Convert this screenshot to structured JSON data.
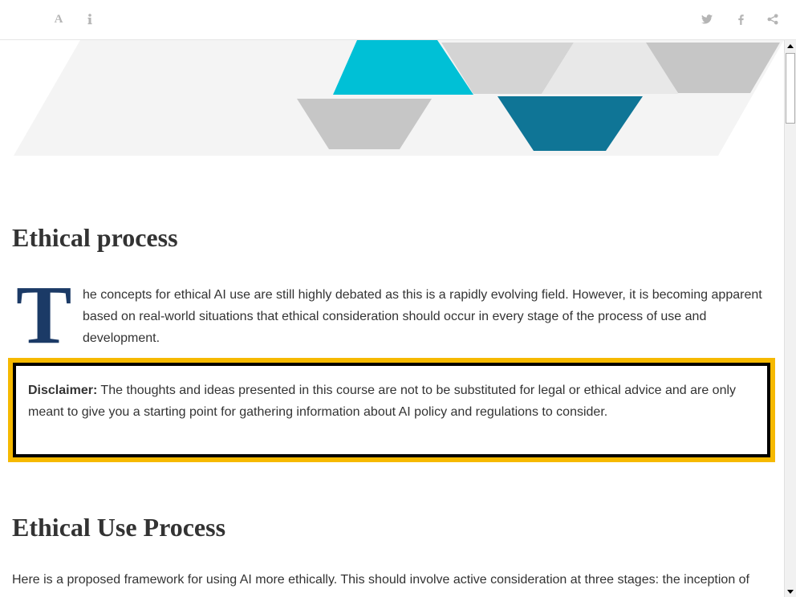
{
  "toolbar": {
    "font_icon_glyph": "A",
    "left_icons": [
      "font-size-icon",
      "info-icon"
    ],
    "right_icons": [
      "twitter-icon",
      "facebook-icon",
      "share-icon"
    ],
    "icon_color": "#b5b5b5"
  },
  "banner": {
    "colors": {
      "cyan": "#00c0d6",
      "teal": "#0f7596",
      "grey": "#c6c6c6",
      "light_grey": "#e8e8e8",
      "pale": "#f4f4f4"
    }
  },
  "article": {
    "heading_1": "Ethical process",
    "dropcap": "T",
    "intro_text": "he concepts for ethical AI use are still highly debated as this is a rapidly evolving field. However, it is becoming apparent based on real-world situations that ethical consideration should occur in every stage of the process of use and development.",
    "disclaimer_label": "Disclaimer:",
    "disclaimer_text": " The thoughts and ideas presented in this course are not to be substituted for legal or ethical advice and are only meant to give you a starting point for gathering information about AI policy and regulations to consider.",
    "disclaimer_border_color": "#f6b900",
    "heading_2": "Ethical Use Process",
    "lower_text": "Here is a proposed framework for using AI more ethically. This should involve active consideration at three stages: the inception of"
  }
}
